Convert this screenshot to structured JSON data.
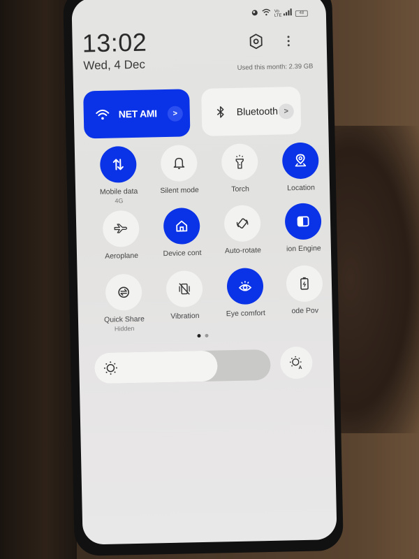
{
  "status_bar": {
    "icons": [
      "alarm-icon",
      "wifi-icon",
      "volte-icon",
      "signal-icon",
      "battery-icon"
    ],
    "volte_text": "Vo LTE",
    "battery_level": "48"
  },
  "header": {
    "time": "13:02",
    "date": "Wed, 4 Dec",
    "data_usage": "Used this month: 2.39 GB"
  },
  "big_tiles": [
    {
      "label": "NET AMI",
      "icon": "wifi-icon",
      "active": true,
      "chevron": ">"
    },
    {
      "label": "Bluetooth",
      "icon": "bluetooth-icon",
      "active": false,
      "chevron": ">"
    }
  ],
  "quick_settings": [
    {
      "label": "Mobile data",
      "sub": "4G",
      "icon": "mobile-data-icon",
      "active": true
    },
    {
      "label": "Silent mode",
      "icon": "bell-icon",
      "active": false
    },
    {
      "label": "Torch",
      "icon": "torch-icon",
      "active": false
    },
    {
      "label": "Location",
      "icon": "location-icon",
      "active": true
    },
    {
      "label": "Aeroplane",
      "icon": "airplane-icon",
      "active": false
    },
    {
      "label": "Device cont",
      "icon": "home-icon",
      "active": true
    },
    {
      "label": "Auto-rotate",
      "icon": "rotate-icon",
      "active": false
    },
    {
      "label": "ion Engine",
      "icon": "vision-engine-icon",
      "active": true
    },
    {
      "label": "Quick Share",
      "sub": "Hidden",
      "icon": "quick-share-icon",
      "active": false
    },
    {
      "label": "Vibration",
      "icon": "vibration-off-icon",
      "active": false
    },
    {
      "label": "Eye comfort",
      "icon": "eye-icon",
      "active": true
    },
    {
      "label": "ode   Pov",
      "icon": "battery-saver-icon",
      "active": false
    }
  ],
  "pager": {
    "current": 1,
    "total": 2
  },
  "brightness": {
    "level_percent": 70
  },
  "colors": {
    "accent": "#0a32e6",
    "tile_off": "#f2f2f1",
    "panel_bg": "#e4e4e2"
  }
}
